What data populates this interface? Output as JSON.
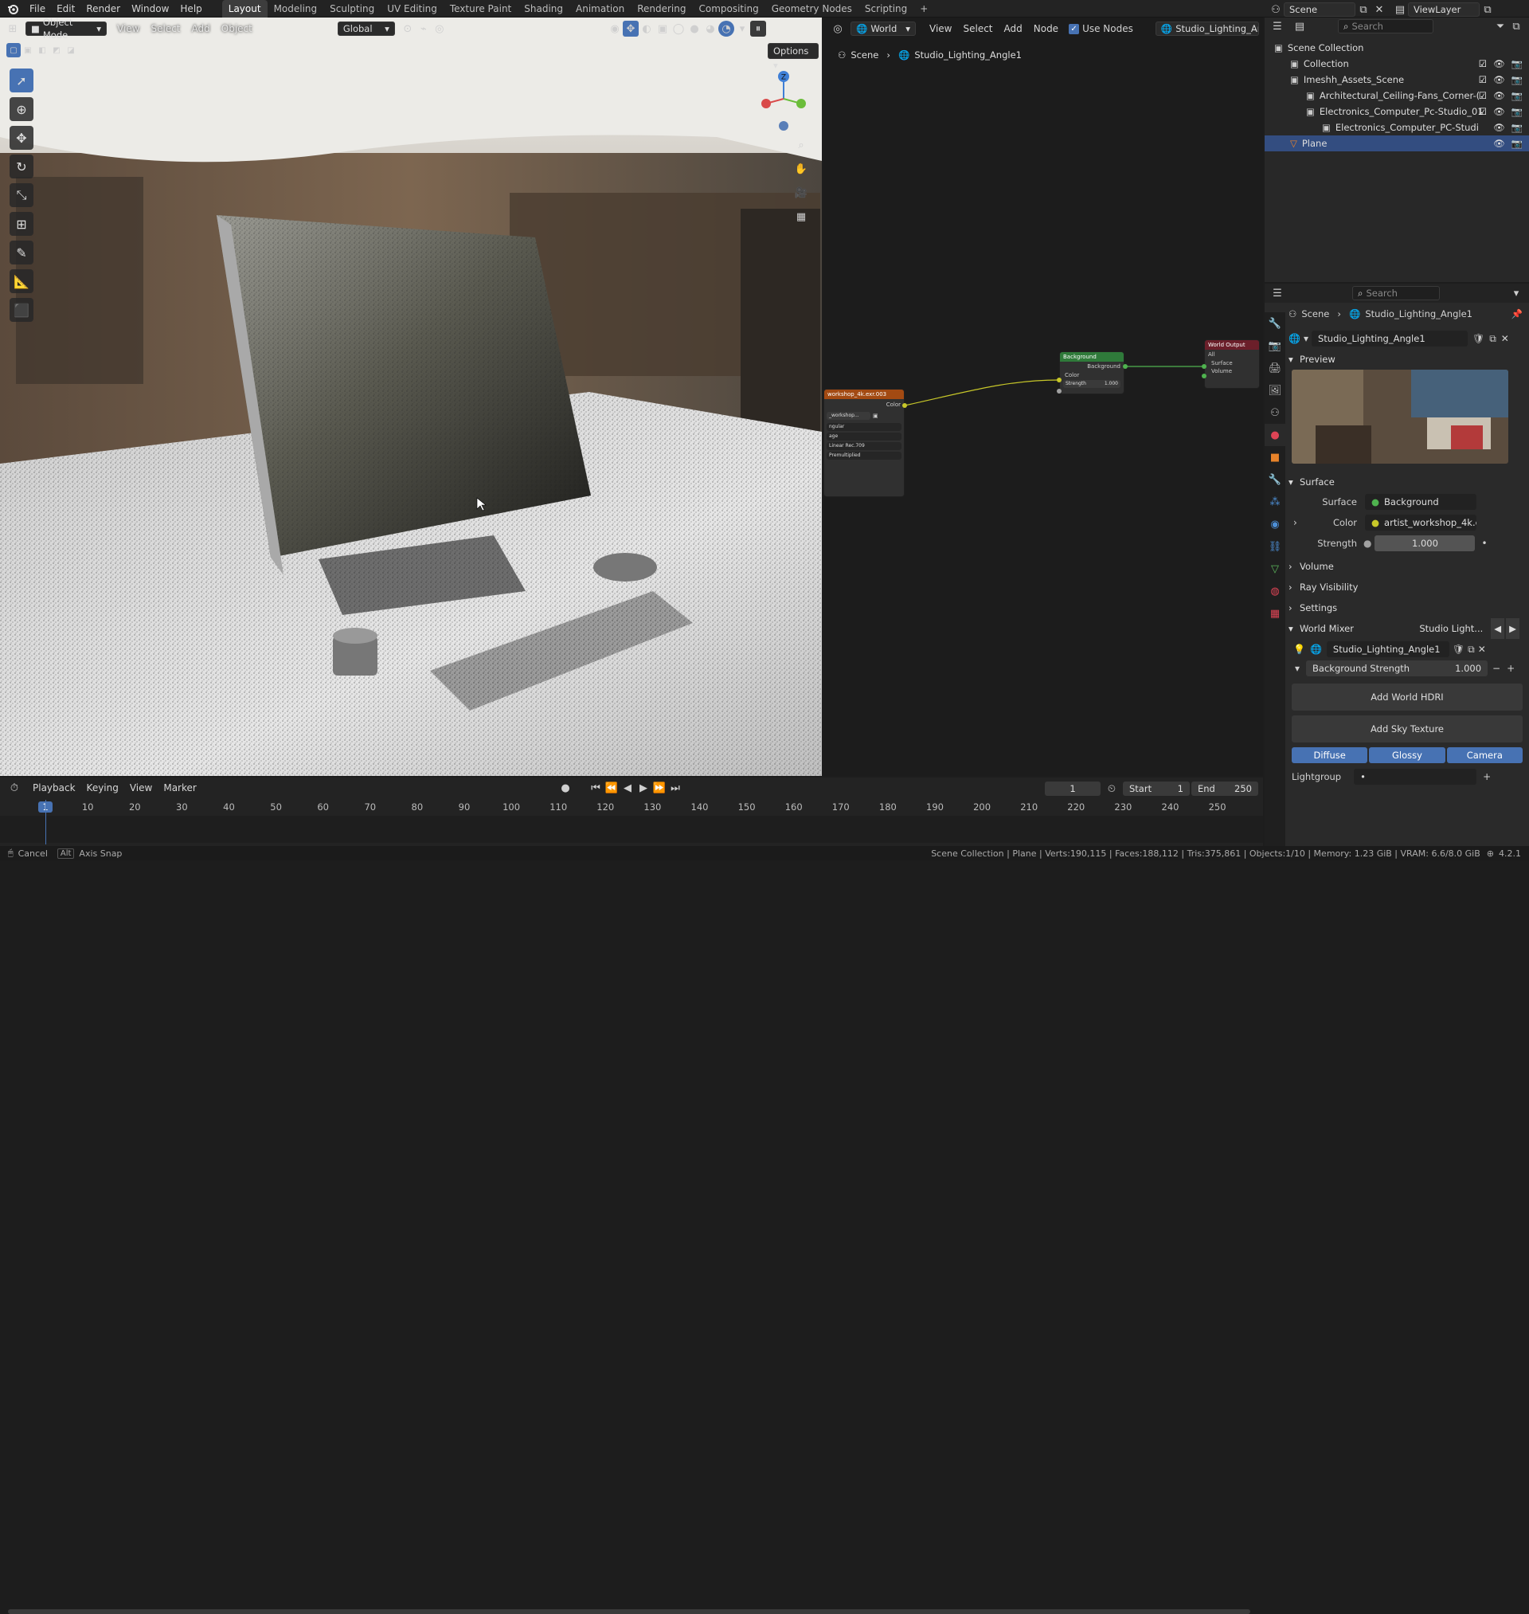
{
  "topbar": {
    "menus": [
      "File",
      "Edit",
      "Render",
      "Window",
      "Help"
    ],
    "workspaces": [
      "Layout",
      "Modeling",
      "Sculpting",
      "UV Editing",
      "Texture Paint",
      "Shading",
      "Animation",
      "Rendering",
      "Compositing",
      "Geometry Nodes",
      "Scripting"
    ],
    "active_workspace": "Layout",
    "add_tab": "+",
    "scene_label": "Scene",
    "viewlayer_label": "ViewLayer"
  },
  "viewport": {
    "mode": "Object Mode",
    "menus": [
      "View",
      "Select",
      "Add",
      "Object"
    ],
    "transform_orientation": "Global",
    "options_label": "Options",
    "gizmo": {
      "z_label": "Z"
    }
  },
  "node_editor": {
    "world_label": "World",
    "menus": [
      "View",
      "Select",
      "Add",
      "Node"
    ],
    "use_nodes_label": "Use Nodes",
    "use_nodes_checked": true,
    "world_name": "Studio_Lighting_Angle1",
    "breadcrumb": [
      "Scene",
      "Studio_Lighting_Angle1"
    ],
    "env_node": {
      "title": "workshop_4k.exr.003",
      "out": "Color",
      "img": "_workshop...",
      "rows": [
        "ngular",
        "age",
        "Linear Rec.709",
        "Premultiplied"
      ]
    },
    "bg_node": {
      "title": "Background",
      "out": "Background",
      "in1": "Color",
      "in2": "Strength",
      "strength": "1.000"
    },
    "out_node": {
      "title": "World Output",
      "target": "All",
      "in1": "Surface",
      "in2": "Volume"
    }
  },
  "outliner": {
    "search_placeholder": "Search",
    "rows": [
      {
        "label": "Scene Collection",
        "indent": 0,
        "chk": false
      },
      {
        "label": "Collection",
        "indent": 1,
        "chk": true
      },
      {
        "label": "Imeshh_Assets_Scene",
        "indent": 1,
        "chk": true
      },
      {
        "label": "Architectural_Ceiling-Fans_Corner-(",
        "indent": 2,
        "chk": true
      },
      {
        "label": "Electronics_Computer_Pc-Studio_01",
        "indent": 2,
        "chk": true
      },
      {
        "label": "Electronics_Computer_PC-Studi",
        "indent": 3,
        "chk": false
      },
      {
        "label": "Plane",
        "indent": 1,
        "chk": false,
        "sel": true
      }
    ]
  },
  "properties": {
    "search_placeholder": "Search",
    "breadcrumb": [
      "Scene",
      "Studio_Lighting_Angle1"
    ],
    "world_name": "Studio_Lighting_Angle1",
    "preview_label": "Preview",
    "surface_section": "Surface",
    "surface_label": "Surface",
    "surface_value": "Background",
    "color_label": "Color",
    "color_value": "artist_workshop_4k.exr....",
    "strength_label": "Strength",
    "strength_value": "1.000",
    "collapsed": [
      "Volume",
      "Ray Visibility",
      "Settings"
    ],
    "world_mixer": "World Mixer",
    "world_mixer_value": "Studio Light...",
    "mixer_world": "Studio_Lighting_Angle1",
    "bg_strength_label": "Background Strength",
    "bg_strength_value": "1.000",
    "add_hdri": "Add World HDRI",
    "add_sky": "Add Sky Texture",
    "ray_buttons": [
      "Diffuse",
      "Glossy",
      "Camera"
    ],
    "lightgroup_label": "Lightgroup"
  },
  "timeline": {
    "menus": [
      "Playback",
      "Keying",
      "View",
      "Marker"
    ],
    "current_frame": "1",
    "start_label": "Start",
    "start": "1",
    "end_label": "End",
    "end": "250",
    "ticks": [
      "1",
      "10",
      "20",
      "30",
      "40",
      "50",
      "60",
      "70",
      "80",
      "90",
      "100",
      "110",
      "120",
      "130",
      "140",
      "150",
      "160",
      "170",
      "180",
      "190",
      "200",
      "210",
      "220",
      "230",
      "240",
      "250"
    ]
  },
  "statusbar": {
    "cancel": "Cancel",
    "alt": "Alt",
    "axis_snap": "Axis Snap",
    "stats": "Scene Collection | Plane | Verts:190,115 | Faces:188,112 | Tris:375,861 | Objects:1/10 | Memory: 1.23 GiB | VRAM: 6.6/8.0 GiB",
    "version": "4.2.1"
  },
  "colors": {
    "accent": "#4772b3",
    "selected": "#334d80",
    "node_green": "#2f7a3a",
    "node_orange": "#a34a12",
    "socket_yellow": "#c7c729"
  }
}
